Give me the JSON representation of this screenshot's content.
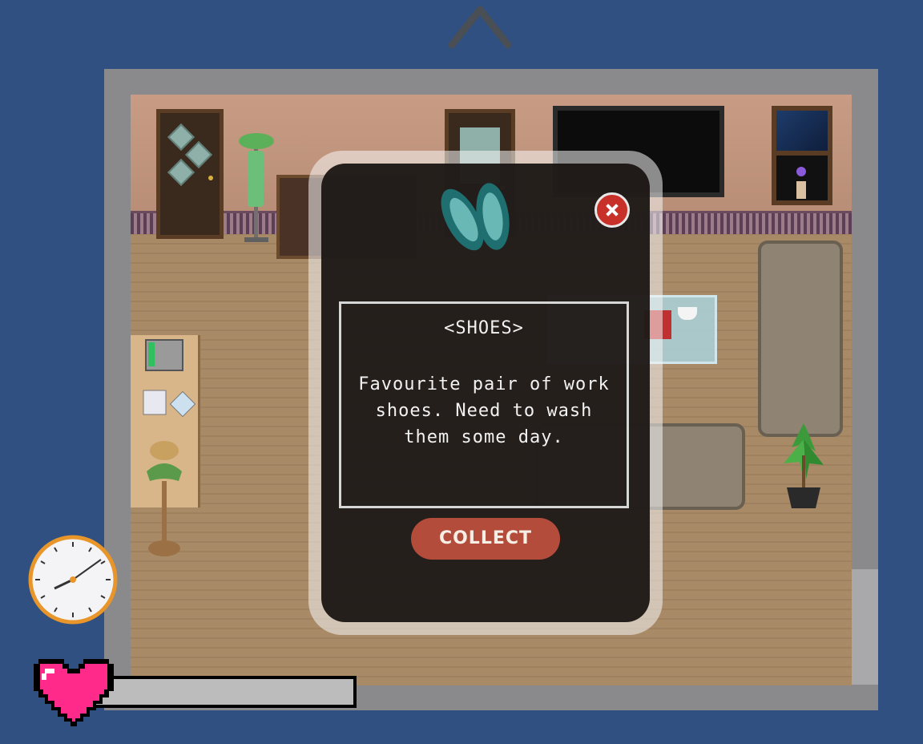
{
  "popup": {
    "title": "<SHOES>",
    "description": "Favourite pair of work shoes. Need to wash them some day.",
    "collect_label": "COLLECT",
    "close_icon": "close-x-icon",
    "item_icon": "shoes-icon"
  },
  "hud": {
    "nav_icon": "chevron-up-icon",
    "clock_icon": "clock-icon",
    "heart_icon": "heart-icon",
    "health_fraction": 0.0
  },
  "colors": {
    "background": "#2f5080",
    "collect_button": "#b34c3b",
    "close_button": "#c8302a",
    "heart": "#ff2a8a"
  }
}
